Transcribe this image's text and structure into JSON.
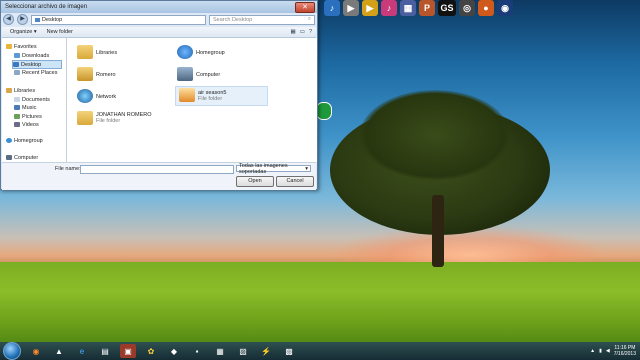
{
  "window": {
    "title": "Seleccionar archivo de imagen",
    "address": "Desktop",
    "search_placeholder": "Search Desktop"
  },
  "toolbar": {
    "organize": "Organize ▾",
    "new_folder": "New folder"
  },
  "navpane": {
    "favorites": "Favorites",
    "downloads": "Downloads",
    "desktop": "Desktop",
    "recent": "Recent Places",
    "libraries": "Libraries",
    "documents": "Documents",
    "music": "Music",
    "pictures": "Pictures",
    "videos": "Videos",
    "homegroup": "Homegroup",
    "computer": "Computer"
  },
  "files": [
    {
      "name": "Libraries",
      "sub": ""
    },
    {
      "name": "Homegroup",
      "sub": ""
    },
    {
      "name": "Romero",
      "sub": ""
    },
    {
      "name": "Computer",
      "sub": ""
    },
    {
      "name": "Network",
      "sub": ""
    },
    {
      "name": "air season5",
      "sub": "File folder"
    },
    {
      "name": "JONATHAN ROMERO",
      "sub": "File folder"
    }
  ],
  "bottom": {
    "file_name_label": "File name:",
    "filter": "Todas las imagenes soportadas",
    "open": "Open",
    "cancel": "Cancel"
  },
  "taskbar": {
    "clock_time": "11:16 PM",
    "clock_date": "7/16/2013"
  },
  "topbar": {
    "gs_label": "GS"
  },
  "colors": {
    "taskbar": "#1c3546",
    "window_frame": "#dfe9f5",
    "selection": "#cde4f7"
  }
}
